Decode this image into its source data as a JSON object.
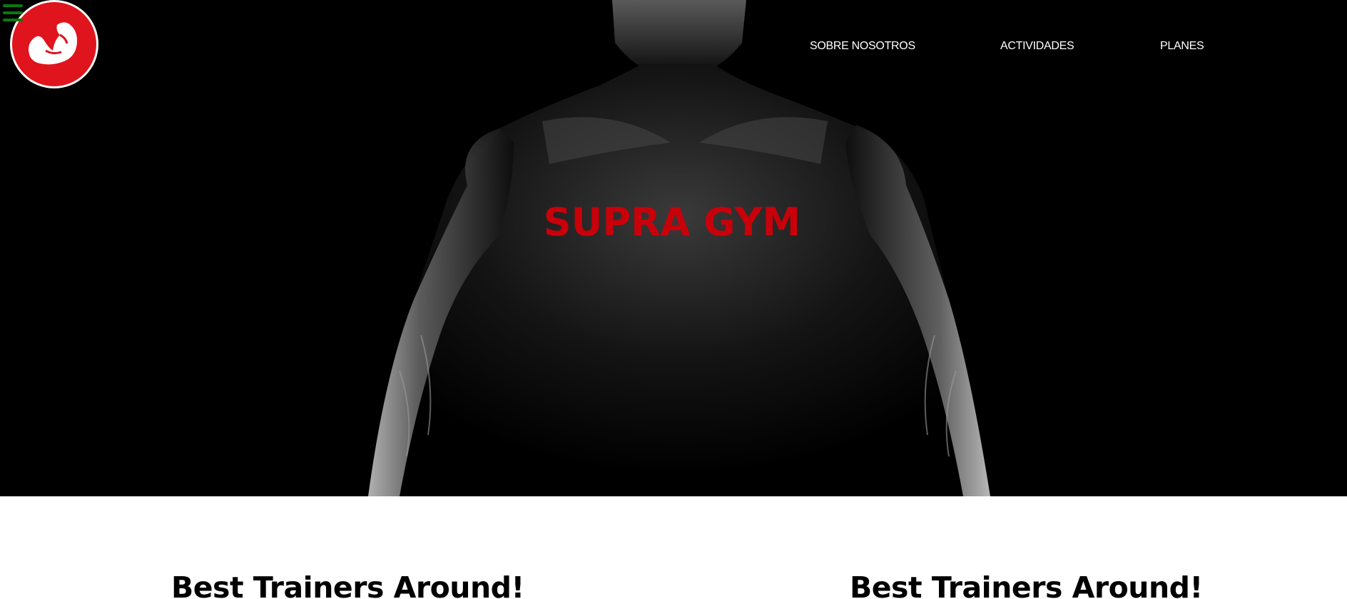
{
  "header": {
    "menu_icon": "hamburger-menu-icon",
    "logo_icon": "flexed-bicep-icon",
    "nav": [
      {
        "label": "SOBRE NOSOTROS"
      },
      {
        "label": "ACTIVIDADES"
      },
      {
        "label": "PLANES"
      }
    ]
  },
  "hero": {
    "title": "SUPRA GYM",
    "image": "muscular-torso-photo"
  },
  "features": [
    {
      "heading": "Best Trainers Around!"
    },
    {
      "heading": "Best Trainers Around!"
    }
  ],
  "colors": {
    "brand_red": "#e0141c",
    "title_red": "#c8000a",
    "menu_green": "#0a7a0a",
    "hero_background": "#000000"
  }
}
